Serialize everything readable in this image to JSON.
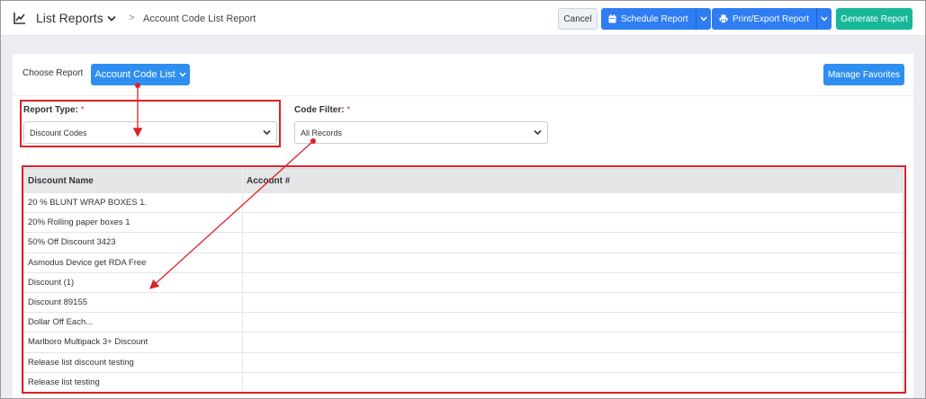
{
  "header": {
    "title": "List Reports",
    "breadcrumb_sep": ">",
    "breadcrumb": "Account Code List Report",
    "buttons": {
      "cancel": "Cancel",
      "schedule": "Schedule Report",
      "print": "Print/Export Report",
      "generate": "Generate Report"
    }
  },
  "panel": {
    "choose_label": "Choose Report",
    "choose_value": "Account Code List",
    "manage_favorites": "Manage Favorites",
    "report_type": {
      "label": "Report Type:",
      "required": "*",
      "value": "Discount Codes"
    },
    "code_filter": {
      "label": "Code Filter:",
      "required": "*",
      "value": "All Records"
    }
  },
  "table": {
    "columns": [
      "Discount Name",
      "Account #"
    ],
    "rows": [
      "20 % BLUNT WRAP BOXES 1.",
      "20% Rolling paper boxes 1",
      "50% Off Discount 3423",
      "Asmodus Device get RDA Free",
      "Discount (1)",
      "Discount 89155",
      "Dollar Off Each...",
      "Marlboro Multipack 3+ Discount",
      "Release list discount testing",
      "Release list testing"
    ]
  },
  "colors": {
    "primary": "#2f7df3",
    "success": "#17b898",
    "annotation": "#e01f26"
  }
}
